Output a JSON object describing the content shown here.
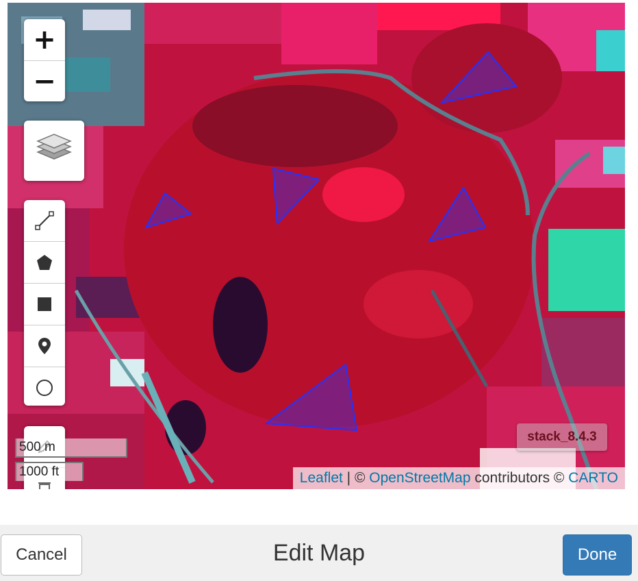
{
  "map": {
    "zoom_in_label": "+",
    "zoom_out_label": "−",
    "scale_metric": "500 m",
    "scale_imperial": "1000 ft",
    "layer_badge": "stack_8.4.3",
    "attribution": {
      "leaflet": "Leaflet",
      "separator": " | © ",
      "osm": "OpenStreetMap",
      "contributors": " contributors © ",
      "carto": "CARTO"
    },
    "draw_tools": [
      "polyline-icon",
      "polygon-icon",
      "rectangle-icon",
      "marker-icon",
      "circle-icon"
    ],
    "edit_tools": [
      "edit-icon",
      "delete-icon"
    ],
    "colors": {
      "shape_fill": "#5a2ab0",
      "shape_stroke": "#2233ff",
      "link": "#0078a8",
      "primary_button": "#337ab7"
    }
  },
  "footer": {
    "cancel_label": "Cancel",
    "title": "Edit Map",
    "done_label": "Done"
  }
}
